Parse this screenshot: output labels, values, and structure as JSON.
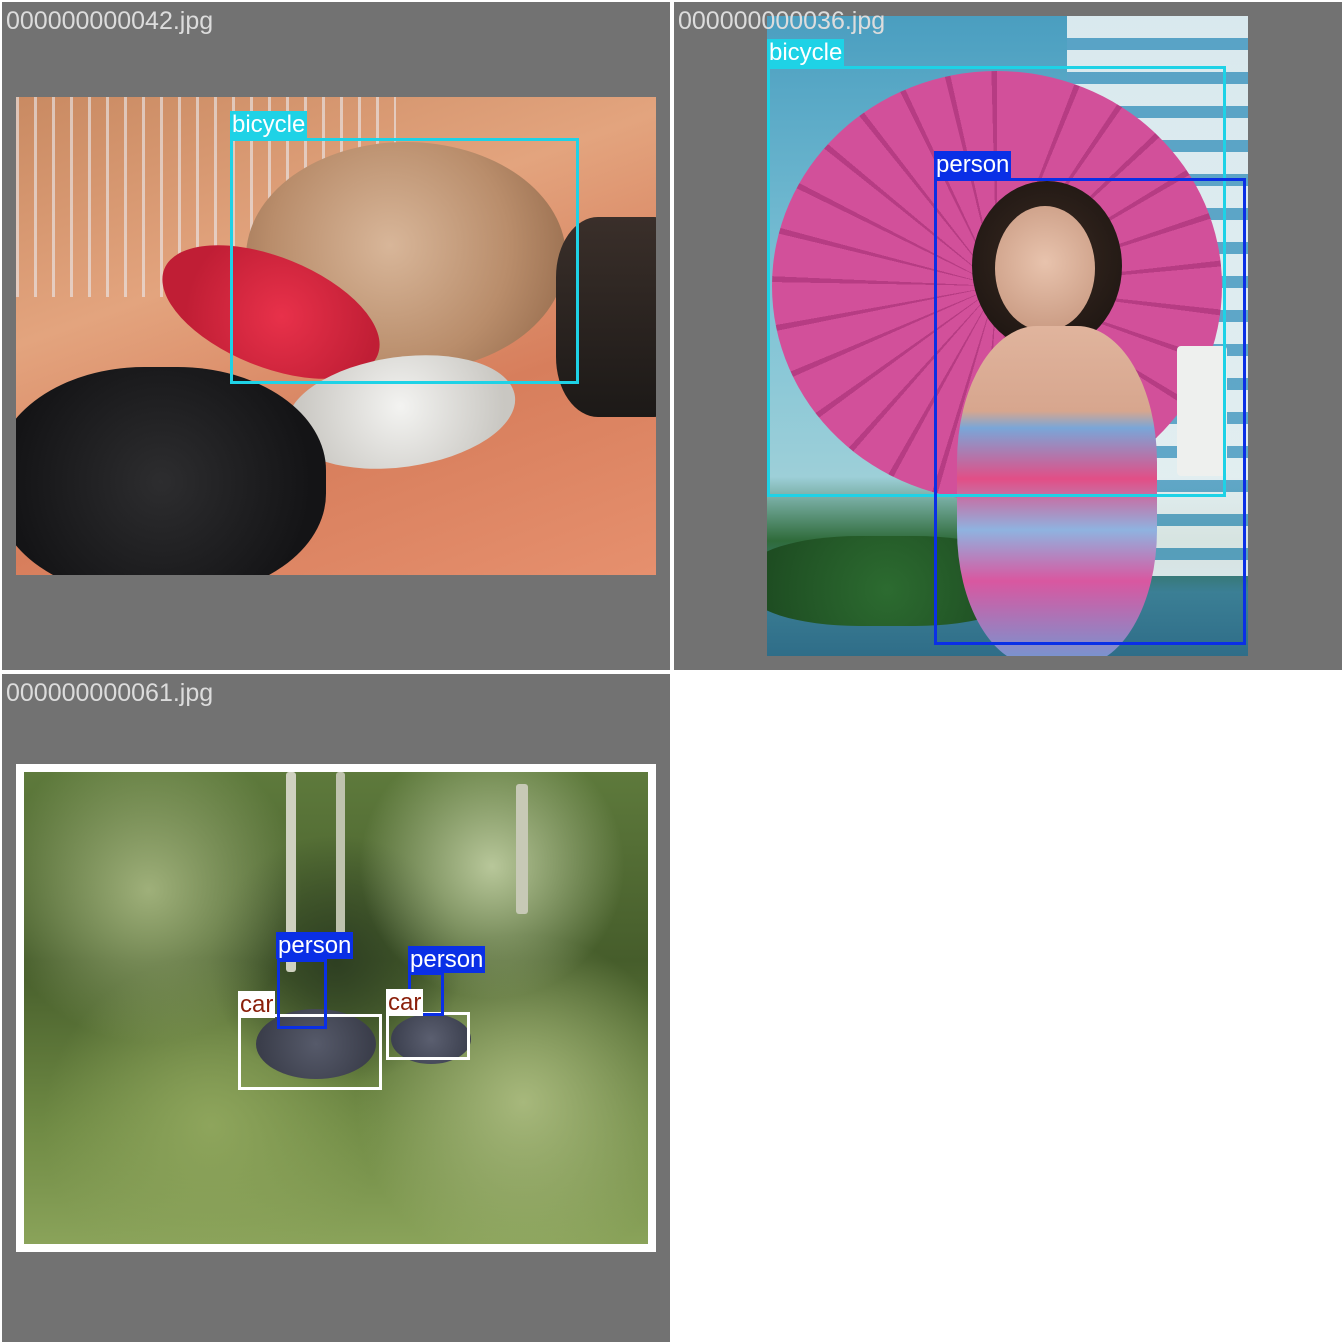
{
  "tiles": [
    {
      "filename": "000000000042.jpg",
      "labels": [
        "bicycle"
      ]
    },
    {
      "filename": "000000000036.jpg",
      "labels": [
        "bicycle",
        "person"
      ]
    },
    {
      "filename": "000000000061.jpg",
      "labels": [
        "person",
        "person",
        "car",
        "car"
      ]
    }
  ],
  "colors": {
    "bicycle": "#1ed2e6",
    "person": "#0a2fe6",
    "car": "#ffffff",
    "car_text": "#8a1f0a",
    "tile_bg": "#727272",
    "filename_text": "#dcdcdc"
  }
}
